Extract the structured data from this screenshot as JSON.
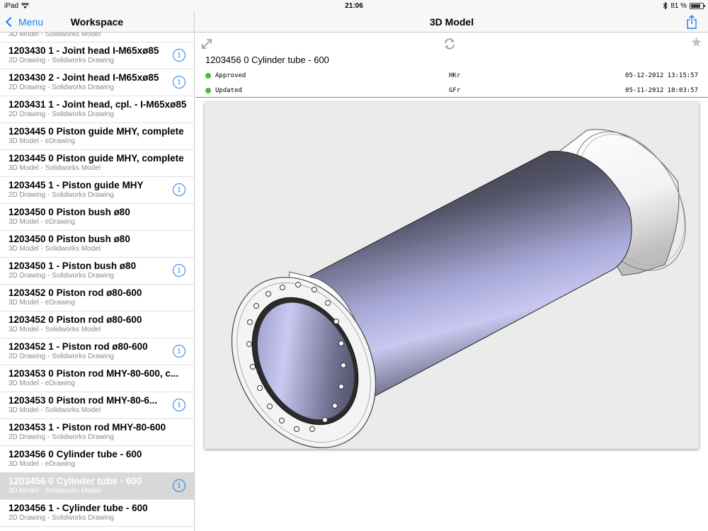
{
  "status_bar": {
    "device": "iPad",
    "time": "21:06",
    "battery": "81 %",
    "battery_level": 0.81
  },
  "sidebar": {
    "back_label": "Menu",
    "title": "Workspace",
    "peek_subtitle": "3D Model - Solidworks Model",
    "items": [
      {
        "title": "1203430 1 - Joint head I-M65xø85",
        "subtitle": "2D Drawing - Solidworks Drawing",
        "info": true
      },
      {
        "title": "1203430 2 - Joint head I-M65xø85",
        "subtitle": "2D Drawing - Solidworks Drawing",
        "info": true
      },
      {
        "title": "1203431 1 - Joint head, cpl. - I-M65xø85",
        "subtitle": "2D Drawing - Solidworks Drawing",
        "info": false
      },
      {
        "title": "1203445 0 Piston guide MHY, complete",
        "subtitle": "3D Model - eDrawing",
        "info": false
      },
      {
        "title": "1203445 0 Piston guide MHY, complete",
        "subtitle": "3D Model - Solidworks Model",
        "info": false
      },
      {
        "title": "1203445 1 - Piston guide MHY",
        "subtitle": "2D Drawing - Solidworks Drawing",
        "info": true
      },
      {
        "title": "1203450 0 Piston bush ø80",
        "subtitle": "3D Model - eDrawing",
        "info": false
      },
      {
        "title": "1203450 0 Piston bush ø80",
        "subtitle": "3D Model - Solidworks Model",
        "info": false
      },
      {
        "title": "1203450 1 - Piston bush ø80",
        "subtitle": "2D Drawing - Solidworks Drawing",
        "info": true
      },
      {
        "title": "1203452 0 Piston rod ø80-600",
        "subtitle": "3D Model - eDrawing",
        "info": false
      },
      {
        "title": "1203452 0 Piston rod ø80-600",
        "subtitle": "3D Model - Solidworks Model",
        "info": false
      },
      {
        "title": "1203452 1 - Piston rod ø80-600",
        "subtitle": "2D Drawing - Solidworks Drawing",
        "info": true
      },
      {
        "title": "1203453 0 Piston rod MHY-80-600, c...",
        "subtitle": "3D Model - eDrawing",
        "info": false
      },
      {
        "title": "1203453 0 Piston rod MHY-80-6...",
        "subtitle": "3D Model - Solidworks Model",
        "info": true
      },
      {
        "title": "1203453 1 - Piston rod MHY-80-600",
        "subtitle": "2D Drawing - Solidworks Drawing",
        "info": false
      },
      {
        "title": "1203456 0 Cylinder tube - 600",
        "subtitle": "3D Model - eDrawing",
        "info": false
      },
      {
        "title": "1203456 0 Cylinder tube - 600",
        "subtitle": "3D Model - Solidworks Model",
        "info": true,
        "selected": true
      },
      {
        "title": "1203456 1 - Cylinder tube - 600",
        "subtitle": "2D Drawing - Solidworks Drawing",
        "info": false
      }
    ]
  },
  "main": {
    "nav_title": "3D Model",
    "doc_title": "1203456 0 Cylinder tube - 600",
    "statuses": [
      {
        "label": "Approved",
        "user": "HKr",
        "date": "05-12-2012 13:15:57"
      },
      {
        "label": "Updated",
        "user": "GFr",
        "date": "05-11-2012 10:03:57"
      }
    ]
  },
  "colors": {
    "accent": "#1a7ef3",
    "status_dot": "#4cba3b",
    "selected_row": "#d8d8d8"
  },
  "icons": [
    "wifi-icon",
    "bluetooth-icon",
    "battery-icon",
    "back-chevron-icon",
    "info-icon",
    "share-icon",
    "expand-icon",
    "refresh-icon",
    "star-icon"
  ]
}
